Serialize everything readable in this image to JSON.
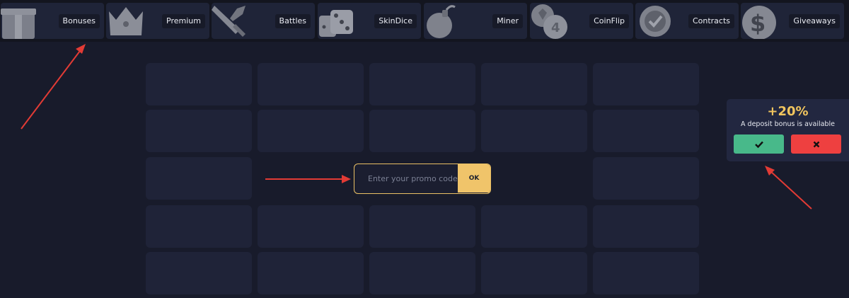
{
  "nav": {
    "items": [
      {
        "label": "Bonuses",
        "icon": "gift-icon"
      },
      {
        "label": "Premium",
        "icon": "crown-icon"
      },
      {
        "label": "Battles",
        "icon": "sword-icon"
      },
      {
        "label": "SkinDice",
        "icon": "dice-icon"
      },
      {
        "label": "Miner",
        "icon": "bomb-icon"
      },
      {
        "label": "CoinFlip",
        "icon": "coin-icon"
      },
      {
        "label": "Contracts",
        "icon": "badge-check-icon"
      },
      {
        "label": "Giveaways",
        "icon": "dollar-coin-icon"
      }
    ]
  },
  "promo": {
    "placeholder": "Enter your promo code",
    "ok_label": "OK"
  },
  "bonus": {
    "percent": "+20%",
    "subtitle": "A deposit bonus is available",
    "accept_icon": "check-icon",
    "decline_icon": "close-icon"
  },
  "colors": {
    "background": "#181b2b",
    "card": "#1f2338",
    "accent_gold": "#f0c46a",
    "accept_green": "#48b98a",
    "decline_red": "#ee4040",
    "annotation_arrow": "#e23b35"
  }
}
